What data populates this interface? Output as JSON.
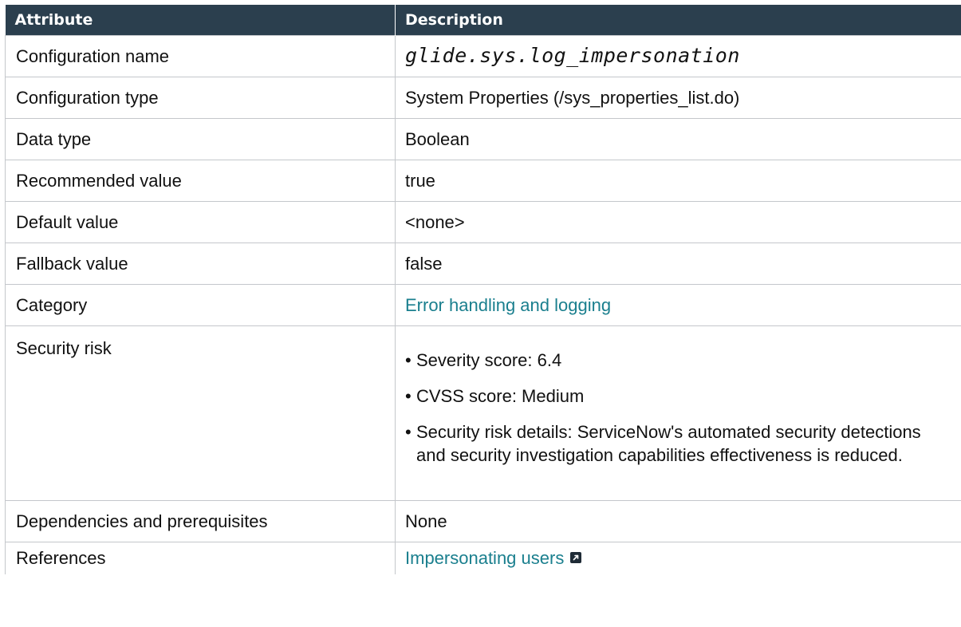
{
  "header": {
    "attribute": "Attribute",
    "description": "Description"
  },
  "rows": {
    "config_name": {
      "label": "Configuration name",
      "value": "glide.sys.log_impersonation"
    },
    "config_type": {
      "label": "Configuration type",
      "value": "System Properties (/sys_properties_list.do)"
    },
    "data_type": {
      "label": "Data type",
      "value": "Boolean"
    },
    "recommended": {
      "label": "Recommended value",
      "value": "true"
    },
    "default": {
      "label": "Default value",
      "value": "<none>"
    },
    "fallback": {
      "label": "Fallback value",
      "value": "false"
    },
    "category": {
      "label": "Category",
      "value": "Error handling and logging"
    },
    "security_risk": {
      "label": "Security risk",
      "items": [
        "Severity score: 6.4",
        "CVSS score: Medium",
        "Security risk details: ServiceNow's automated security detections and security investigation capabilities effectiveness is reduced."
      ]
    },
    "dependencies": {
      "label": "Dependencies and prerequisites",
      "value": "None"
    },
    "references": {
      "label": "References",
      "value": "Impersonating users",
      "icon": "external-link-icon"
    }
  },
  "colors": {
    "header_bg": "#2b3f4e",
    "link": "#1a7f8e",
    "border": "#c4c7cb"
  }
}
